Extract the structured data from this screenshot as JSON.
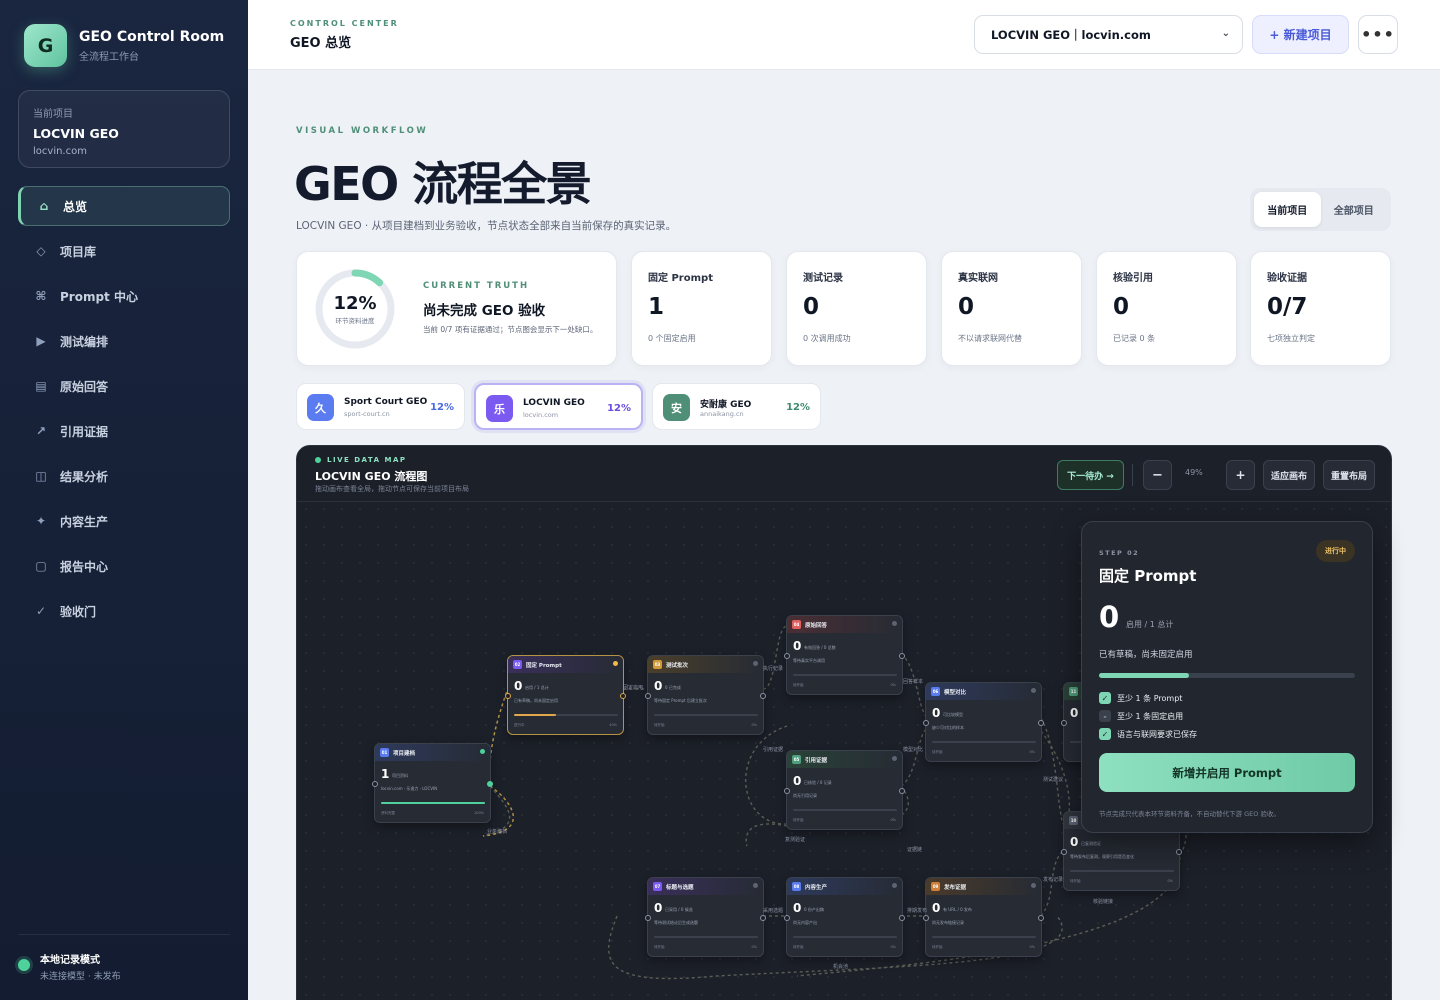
{
  "sidebar": {
    "brand_letter": "G",
    "brand_title": "GEO Control Room",
    "brand_sub": "全流程工作台",
    "current_label": "当前项目",
    "current_name": "LOCVIN GEO",
    "current_domain": "locvin.com",
    "items": [
      {
        "label": "总览",
        "glyph": "⌂",
        "icon": "home-icon",
        "active": true
      },
      {
        "label": "项目库",
        "glyph": "◇",
        "icon": "diamond-icon"
      },
      {
        "label": "Prompt 中心",
        "glyph": "⌘",
        "icon": "command-icon"
      },
      {
        "label": "测试编排",
        "glyph": "▶",
        "icon": "play-icon"
      },
      {
        "label": "原始回答",
        "glyph": "▤",
        "icon": "list-icon"
      },
      {
        "label": "引用证据",
        "glyph": "↗",
        "icon": "arrow-icon"
      },
      {
        "label": "结果分析",
        "glyph": "◫",
        "icon": "columns-icon"
      },
      {
        "label": "内容生产",
        "glyph": "✦",
        "icon": "sparkle-icon"
      },
      {
        "label": "报告中心",
        "glyph": "▢",
        "icon": "square-icon"
      },
      {
        "label": "验收门",
        "glyph": "✓",
        "icon": "check-icon"
      }
    ],
    "footer_title": "本地记录模式",
    "footer_sub": "未连接模型 · 未发布"
  },
  "topbar": {
    "kicker": "CONTROL CENTER",
    "title": "GEO 总览",
    "project_select": "LOCVIN GEO｜locvin.com",
    "new_button": "+ 新建项目",
    "more_button": "•••"
  },
  "hero": {
    "eyebrow": "VISUAL WORKFLOW",
    "title": "GEO 流程全景",
    "subtitle": "LOCVIN GEO · 从项目建档到业务验收，节点状态全部来自当前保存的真实记录。",
    "segments": [
      "当前项目",
      "全部项目"
    ],
    "segment_active": 0
  },
  "truth": {
    "percent": "12%",
    "percent_value": 0.12,
    "ring_label": "环节资料进度",
    "kicker": "CURRENT TRUTH",
    "title": "尚未完成 GEO 验收",
    "desc": "当前 0/7 项有证据通过；节点图会显示下一处缺口。"
  },
  "stats": [
    {
      "label": "固定 Prompt",
      "value": "1",
      "desc": "0 个固定启用"
    },
    {
      "label": "测试记录",
      "value": "0",
      "desc": "0 次调用成功"
    },
    {
      "label": "真实联网",
      "value": "0",
      "desc": "不以请求联网代替"
    },
    {
      "label": "核验引用",
      "value": "0",
      "desc": "已记录 0 条"
    },
    {
      "label": "验收证据",
      "value": "0/7",
      "desc": "七项独立判定"
    }
  ],
  "projects": [
    {
      "avatar": "久",
      "name": "Sport Court GEO",
      "domain": "sport-court.cn",
      "percent": "12%",
      "color": "#5b7cf0",
      "pcolor": "#4a68e0"
    },
    {
      "avatar": "乐",
      "name": "LOCVIN GEO",
      "domain": "locvin.com",
      "percent": "12%",
      "color": "#7a5af0",
      "pcolor": "#6a4ce0",
      "selected": true
    },
    {
      "avatar": "安",
      "name": "安耐康 GEO",
      "domain": "annaikang.cn",
      "percent": "12%",
      "color": "#4f8f78",
      "pcolor": "#3e8a6c"
    }
  ],
  "map": {
    "live": "LIVE DATA MAP",
    "title": "LOCVIN GEO 流程图",
    "sub": "拖动画布查看全局，拖动节点可保存当前项目布局",
    "next_button": "下一待办 →",
    "zoom_out": "−",
    "zoom": "49%",
    "zoom_in": "+",
    "fit_button": "适应画布",
    "reset_button": "重置布局",
    "edge_labels": [
      "业务建档",
      "固定启用",
      "执行记录",
      "回答样本",
      "模型对比",
      "引用证据",
      "证据链",
      "测试建议",
      "采用选题",
      "排期发布",
      "发布记录",
      "复测验证",
      "机会池",
      "核验链接"
    ],
    "nodes": [
      {
        "num": "01",
        "title": "项目建档",
        "value": "1",
        "unit": "项目资料",
        "desc": "locvin.com · 乐逸力 · LOCVIN",
        "left": "资料完整",
        "pct": "100%",
        "color": "#5b7cf0",
        "head": "#2e3a5c",
        "status": "#4fd19c",
        "bar": "#4fd19c",
        "fill": 1.0
      },
      {
        "num": "02",
        "title": "固定 Prompt",
        "value": "0",
        "unit": "启用 / 1 总计",
        "desc": "已有草稿，尚未固定启用",
        "left": "进行中",
        "pct": "40%",
        "color": "#7a5af0",
        "head": "#3a2f5a",
        "status": "#f1b94a",
        "bar": "#e0a84a",
        "fill": 0.4,
        "active": true
      },
      {
        "num": "03",
        "title": "测试批次",
        "value": "0",
        "unit": "0 已完成",
        "desc": "等待固定 Prompt 后建立批次",
        "left": "待开始",
        "pct": "0%",
        "color": "#d09a3a",
        "head": "#4a3f2a",
        "status": "#5c6473",
        "bar": "#5c6473",
        "fill": 0
      },
      {
        "num": "04",
        "title": "原始回答",
        "value": "0",
        "unit": "有效回答 / 0 总数",
        "desc": "等待真实平台调用",
        "left": "待开始",
        "pct": "0%",
        "color": "#e06060",
        "head": "#4a2e34",
        "status": "#5c6473",
        "bar": "#5c6473",
        "fill": 0
      },
      {
        "num": "05",
        "title": "引用证据",
        "value": "0",
        "unit": "已核验 / 0 记录",
        "desc": "尚无引用记录",
        "left": "待开始",
        "pct": "0%",
        "color": "#4f9f7f",
        "head": "#2a4238",
        "status": "#5c6473",
        "bar": "#5c6473",
        "fill": 0
      },
      {
        "num": "06",
        "title": "模型对比",
        "value": "0",
        "unit": "可比较模型",
        "desc": "缺少可对比的样本",
        "left": "待开始",
        "pct": "0%",
        "color": "#5b7cf0",
        "head": "#2e3a5c",
        "status": "#5c6473",
        "bar": "#5c6473",
        "fill": 0
      },
      {
        "num": "07",
        "title": "标题与选题",
        "value": "0",
        "unit": "已采用 / 0 候选",
        "desc": "等待测试结论后生成选题",
        "left": "待开始",
        "pct": "0%",
        "color": "#7a5af0",
        "head": "#3a2f5a",
        "status": "#5c6473",
        "bar": "#5c6473",
        "fill": 0
      },
      {
        "num": "08",
        "title": "内容生产",
        "value": "0",
        "unit": "0 份产出稿",
        "desc": "尚无内容产出",
        "left": "待开始",
        "pct": "0%",
        "color": "#5b7cf0",
        "head": "#2e3a5c",
        "status": "#5c6473",
        "bar": "#5c6473",
        "fill": 0
      },
      {
        "num": "09",
        "title": "发布证据",
        "value": "0",
        "unit": "有 URL / 0 发布",
        "desc": "尚无发布链接记录",
        "left": "待开始",
        "pct": "0%",
        "color": "#d0803a",
        "head": "#4a3a2a",
        "status": "#5c6473",
        "bar": "#5c6473",
        "fill": 0
      },
      {
        "num": "10",
        "title": "",
        "value": "0",
        "unit": "已复测验证",
        "desc": "等待发布后复测，观察引用是否变化",
        "left": "待开始",
        "pct": "0%",
        "color": "#5c6473",
        "head": "#30353f",
        "status": "#5c6473",
        "bar": "#5c6473",
        "fill": 0
      },
      {
        "num": "11",
        "title": "",
        "value": "0",
        "unit": "",
        "desc": "",
        "left": "",
        "pct": "",
        "color": "#4f9f7f",
        "head": "#2a4238",
        "status": "#5c6473",
        "bar": "#5c6473",
        "fill": 0
      }
    ]
  },
  "panel": {
    "kicker": "STEP 02",
    "title": "固定 Prompt",
    "badge": "进行中",
    "value": "0",
    "unit": "启用 / 1 总计",
    "desc": "已有草稿，尚未固定启用",
    "progress": 0.35,
    "checks": [
      {
        "label": "至少 1 条 Prompt",
        "done": true
      },
      {
        "label": "至少 1 条固定启用",
        "done": false
      },
      {
        "label": "语言与联网要求已保存",
        "done": true
      }
    ],
    "cta": "新增并启用 Prompt",
    "note": "节点完成只代表本环节资料齐备，不自动替代下游 GEO 验收。"
  }
}
